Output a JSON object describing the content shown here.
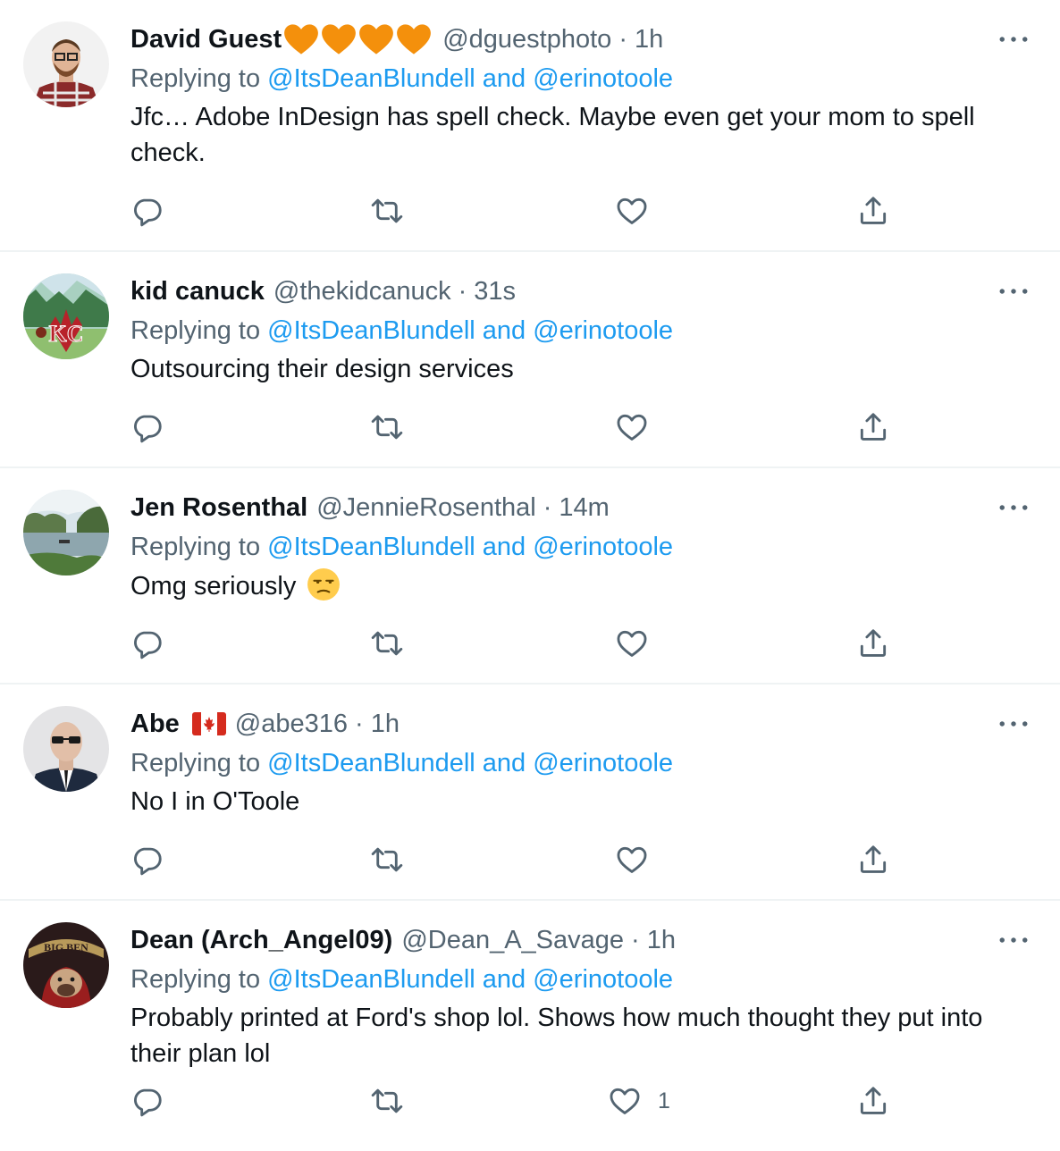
{
  "tweets": [
    {
      "name": "David Guest",
      "emoji_hearts": [
        "orange-heart",
        "orange-heart",
        "orange-heart",
        "orange-heart"
      ],
      "handle": "@dguestphoto",
      "separator": "·",
      "time": "1h",
      "replying_prefix": "Replying to",
      "replying_to": "@ItsDeanBlundell and @erinotoole",
      "text": "Jfc… Adobe InDesign has spell check. Maybe even get your mom to spell check.",
      "like_count": ""
    },
    {
      "name": "kid canuck",
      "handle": "@thekidcanuck",
      "separator": "·",
      "time": "31s",
      "replying_prefix": "Replying to",
      "replying_to": "@ItsDeanBlundell and @erinotoole",
      "text": "Outsourcing their design services",
      "like_count": ""
    },
    {
      "name": "Jen Rosenthal",
      "handle": "@JennieRosenthal",
      "separator": "·",
      "time": "14m",
      "replying_prefix": "Replying to",
      "replying_to": "@ItsDeanBlundell and @erinotoole",
      "text": "Omg seriously",
      "text_emoji": "unamused-face",
      "like_count": ""
    },
    {
      "name": "Abe",
      "name_flag": "canada-flag",
      "handle": "@abe316",
      "separator": "·",
      "time": "1h",
      "replying_prefix": "Replying to",
      "replying_to": "@ItsDeanBlundell and @erinotoole",
      "text": "No I in O'Toole",
      "like_count": ""
    },
    {
      "name": "Dean (Arch_Angel09)",
      "handle": "@Dean_A_Savage",
      "separator": "·",
      "time": "1h",
      "replying_prefix": "Replying to",
      "replying_to": "@ItsDeanBlundell and @erinotoole",
      "text": "Probably printed at Ford's shop lol. Shows how much thought they put into their plan lol",
      "like_count": "1"
    }
  ],
  "colors": {
    "link": "#1d9bf0",
    "secondary_text": "#536471",
    "primary_text": "#0f1419",
    "divider": "#eff3f4",
    "heart_emoji": "#f4900c"
  },
  "icons": [
    "more-icon",
    "reply-icon",
    "retweet-icon",
    "like-icon",
    "share-icon"
  ]
}
